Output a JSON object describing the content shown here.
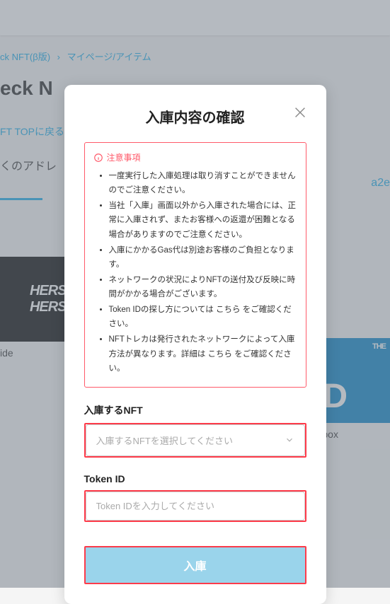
{
  "breadcrumb": {
    "item1": "ck NFT(β版)",
    "item2": "マイページ/アイテム"
  },
  "page_title": "eck N",
  "back_link": "FT TOPに戻る",
  "desc_prefix": "くのアドレ",
  "desc_addr": "a2e",
  "card1_label": "ide",
  "card2_label": "e Sandbox",
  "card2_the": "THE",
  "card1_text": "HERSI\nHERSI",
  "card2_text": "AND",
  "modal": {
    "title": "入庫内容の確認",
    "notice_header": "注意事項",
    "notes": [
      "一度実行した入庫処理は取り消すことができませんのでご注意ください。",
      "当社「入庫」画面以外から入庫された場合には、正常に入庫されず、またお客様への返還が困難となる場合がありますのでご注意ください。",
      "入庫にかかるGas代は別途お客様のご負担となります。",
      "ネットワークの状況によりNFTの送付及び反映に時間がかかる場合がございます。",
      "Token IDの探し方については こちら をご確認ください。",
      "NFTトレカは発行されたネットワークによって入庫方法が異なります。詳細は こちら をご確認ください。"
    ],
    "nft_label": "入庫するNFT",
    "nft_placeholder": "入庫するNFTを選択してください",
    "token_label": "Token ID",
    "token_placeholder": "Token IDを入力してください",
    "submit": "入庫"
  }
}
